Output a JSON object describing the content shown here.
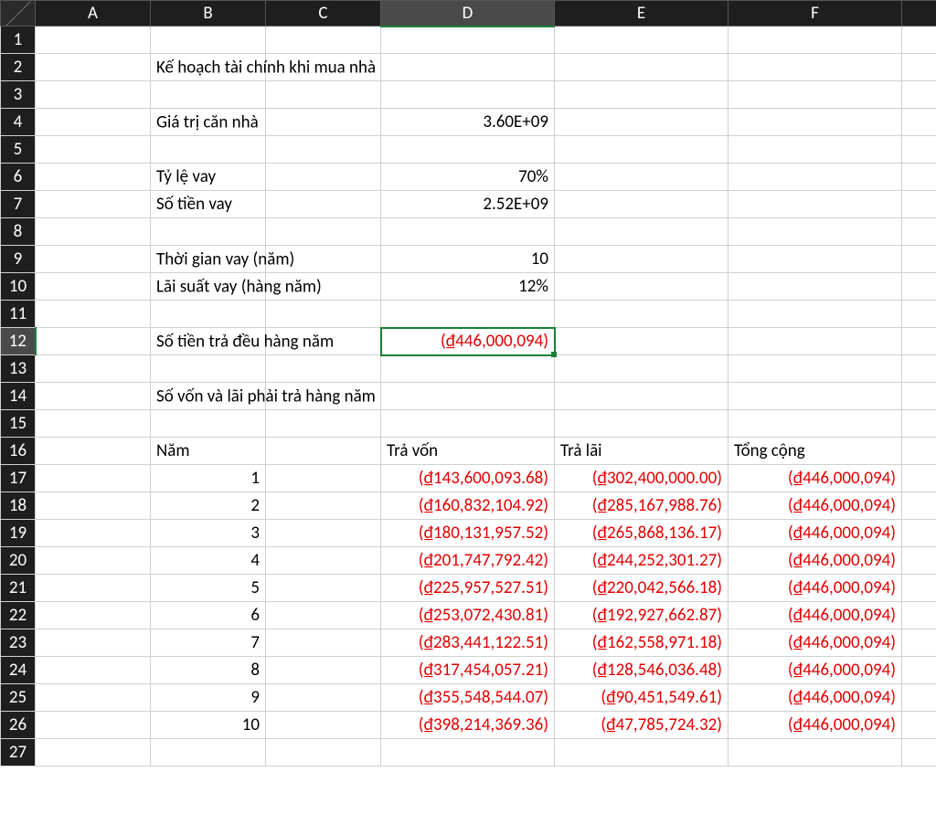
{
  "cols": [
    "A",
    "B",
    "C",
    "D",
    "E",
    "F"
  ],
  "selectedCol": "D",
  "selectedRow": 12,
  "labels": {
    "title": "Kế hoạch tài chính khi mua nhà",
    "houseValue": "Giá trị căn nhà",
    "loanRatio": "Tỷ lệ vay",
    "loanAmount": "Số tiền vay",
    "loanTerm": "Thời gian vay (năm)",
    "interestRate": "Lãi suất vay (hàng năm)",
    "annualPayment": "Số tiền trả đều hàng năm",
    "scheduleTitle": "Số vốn và lãi phải trả hàng năm",
    "year": "Năm",
    "principal": "Trả vốn",
    "interest": "Trả lãi",
    "total": "Tổng cộng"
  },
  "vals": {
    "houseValue": "3.60E+09",
    "loanRatio": "70%",
    "loanAmount": "2.52E+09",
    "loanTerm": "10",
    "interestRate": "12%",
    "annualPayment": "(₫446,000,094)"
  },
  "schedule": [
    {
      "yr": "1",
      "p": "(₫143,600,093.68)",
      "i": "(₫302,400,000.00)",
      "t": "(₫446,000,094)"
    },
    {
      "yr": "2",
      "p": "(₫160,832,104.92)",
      "i": "(₫285,167,988.76)",
      "t": "(₫446,000,094)"
    },
    {
      "yr": "3",
      "p": "(₫180,131,957.52)",
      "i": "(₫265,868,136.17)",
      "t": "(₫446,000,094)"
    },
    {
      "yr": "4",
      "p": "(₫201,747,792.42)",
      "i": "(₫244,252,301.27)",
      "t": "(₫446,000,094)"
    },
    {
      "yr": "5",
      "p": "(₫225,957,527.51)",
      "i": "(₫220,042,566.18)",
      "t": "(₫446,000,094)"
    },
    {
      "yr": "6",
      "p": "(₫253,072,430.81)",
      "i": "(₫192,927,662.87)",
      "t": "(₫446,000,094)"
    },
    {
      "yr": "7",
      "p": "(₫283,441,122.51)",
      "i": "(₫162,558,971.18)",
      "t": "(₫446,000,094)"
    },
    {
      "yr": "8",
      "p": "(₫317,454,057.21)",
      "i": "(₫128,546,036.48)",
      "t": "(₫446,000,094)"
    },
    {
      "yr": "9",
      "p": "(₫355,548,544.07)",
      "i": "(₫90,451,549.61)",
      "t": "(₫446,000,094)"
    },
    {
      "yr": "10",
      "p": "(₫398,214,369.36)",
      "i": "(₫47,785,724.32)",
      "t": "(₫446,000,094)"
    }
  ]
}
